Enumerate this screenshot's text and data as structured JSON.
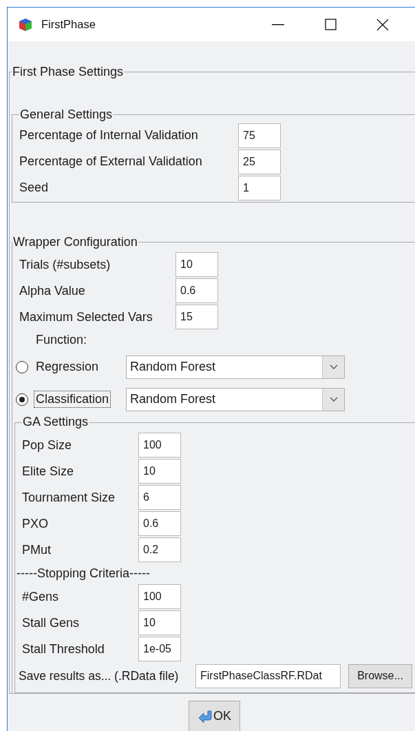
{
  "window": {
    "title": "FirstPhase"
  },
  "settings": {
    "title": "First Phase Settings",
    "general": {
      "title": "General Settings",
      "fields": [
        {
          "label": "Percentage of Internal Validation",
          "value": "75"
        },
        {
          "label": "Percentage of External Validation",
          "value": "25"
        },
        {
          "label": "Seed",
          "value": "1"
        }
      ]
    },
    "wrapper": {
      "title": "Wrapper Configuration",
      "fields": [
        {
          "label": "Trials (#subsets)",
          "value": "10"
        },
        {
          "label": "Alpha Value",
          "value": "0.6"
        },
        {
          "label": "Maximum Selected Vars",
          "value": "15"
        }
      ],
      "function_label": "Function:",
      "options": [
        {
          "label": "Regression",
          "selected": false,
          "focused": false,
          "model": "Random Forest"
        },
        {
          "label": "Classification",
          "selected": true,
          "focused": true,
          "model": "Random Forest"
        }
      ],
      "ga": {
        "title": "GA Settings",
        "fields": [
          {
            "label": "Pop Size",
            "value": "100"
          },
          {
            "label": "Elite Size",
            "value": "10"
          },
          {
            "label": "Tournament Size",
            "value": "6"
          },
          {
            "label": "PXO",
            "value": "0.6"
          },
          {
            "label": "PMut",
            "value": "0.2"
          }
        ],
        "stopping_label": "-----Stopping Criteria-----",
        "stopping_fields": [
          {
            "label": "#Gens",
            "value": "100"
          },
          {
            "label": "Stall Gens",
            "value": "10"
          },
          {
            "label": "Stall Threshold",
            "value": "1e-05"
          }
        ],
        "save": {
          "label": "Save results as... (.RData file)",
          "value": "FirstPhaseClassRF.RDat",
          "button": "Browse..."
        }
      }
    }
  },
  "ok_button": "OK"
}
